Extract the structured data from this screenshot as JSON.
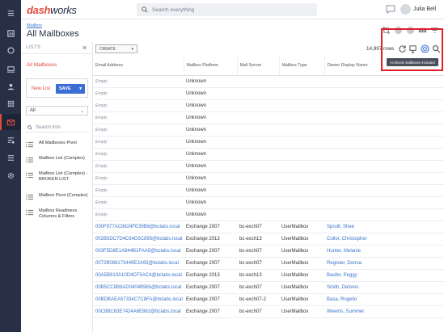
{
  "app": {
    "logo_primary": "dash",
    "logo_secondary": "works",
    "search_placeholder": "Search everything",
    "user_name": "Julia Bell"
  },
  "header": {
    "breadcrumb": "Mailbox",
    "title": "All Mailboxes"
  },
  "lists_panel": {
    "heading": "LISTS",
    "all_mailboxes": "All Mailboxes",
    "new_list": "New List",
    "save_label": "SAVE",
    "filter_value": "All",
    "search_placeholder": "Search lists",
    "items": [
      "All Mailboxes Pivot",
      "Mailbox List (Complex)",
      "Mailbox List (Complex) - BROKEN LIST",
      "Mailbox Pivot (Complex)",
      "Mailbox Readiness Columns & Filters"
    ]
  },
  "toolbar": {
    "create_label": "CREATE",
    "rows_count": "14,897 rows",
    "tooltip": "Archived mailboxes included"
  },
  "table": {
    "columns": [
      "Email Address",
      "Mailbox Platform",
      "Mail Server",
      "Mailbox Type",
      "Owner Display Name"
    ],
    "rows": [
      [
        "Empty",
        "Unknown",
        "",
        "",
        ""
      ],
      [
        "Empty",
        "Unknown",
        "",
        "",
        ""
      ],
      [
        "Empty",
        "Unknown",
        "",
        "",
        ""
      ],
      [
        "Empty",
        "Unknown",
        "",
        "",
        ""
      ],
      [
        "Empty",
        "Unknown",
        "",
        "",
        ""
      ],
      [
        "Empty",
        "Unknown",
        "",
        "",
        ""
      ],
      [
        "Empty",
        "Unknown",
        "",
        "",
        ""
      ],
      [
        "Empty",
        "Unknown",
        "",
        "",
        ""
      ],
      [
        "Empty",
        "Unknown",
        "",
        "",
        ""
      ],
      [
        "Empty",
        "Unknown",
        "",
        "",
        ""
      ],
      [
        "Empty",
        "Unknown",
        "",
        "",
        ""
      ],
      [
        "Empty",
        "Unknown",
        "",
        "",
        ""
      ],
      [
        "000F977AC8824FE39B8@bclabs.local",
        "Exchange 2007",
        "bc-exch07",
        "UserMailbox",
        "Spruill, Shee"
      ],
      [
        "002B5DC7D4D34D5C895@bclabs.local",
        "Exchange 2013",
        "bc-exch13",
        "UserMailbox",
        "Collor, Christopher"
      ],
      [
        "003F5D8E1A844B1FAA5@bclabs.local",
        "Exchange 2007",
        "bc-exch07",
        "UserMailbox",
        "Hunter, Melanie"
      ],
      [
        "0072B088173449E3A93@bclabs.local",
        "Exchange 2007",
        "bc-exch07",
        "UserMailbox",
        "Register, Donna"
      ],
      [
        "00A5B910A10D4CF5AC4@bclabs.local",
        "Exchange 2013",
        "bc-exch13",
        "UserMailbox",
        "Baufer, Peggy"
      ],
      [
        "00B5CC8B9AD0404B965@bclabs.local",
        "Exchange 2007",
        "bc-exch07",
        "UserMailbox",
        "Smith, Delores"
      ],
      [
        "00BDBAEA57334C7C8FA@bclabs.local",
        "Exchange 2007",
        "bc-exch07-2",
        "UserMailbox",
        "Basa, Rogelio"
      ],
      [
        "00C8BC63E7424A6E862@bclabs.local",
        "Exchange 2007",
        "bc-exch07",
        "UserMailbox",
        "Weems, Summer"
      ]
    ]
  },
  "colors": {
    "brand_red": "#e04a3f",
    "rail_bg": "#273046",
    "link_blue": "#3b74c9",
    "save_blue": "#3b6fd6",
    "highlight_red": "#e01f2a"
  },
  "icons": {
    "rail": [
      "menu-icon",
      "dashboard-icon",
      "refresh-icon",
      "device-icon",
      "user-icon",
      "apps-grid-icon",
      "mail-icon",
      "tasks-icon",
      "list-icon",
      "settings-icon"
    ],
    "header": [
      "crop-icon",
      "info-icon",
      "eye-off-icon",
      "columns-icon",
      "filter-icon"
    ],
    "toolbar": [
      "refresh-icon",
      "export-icon",
      "archive-toggle-icon",
      "search-icon"
    ]
  }
}
